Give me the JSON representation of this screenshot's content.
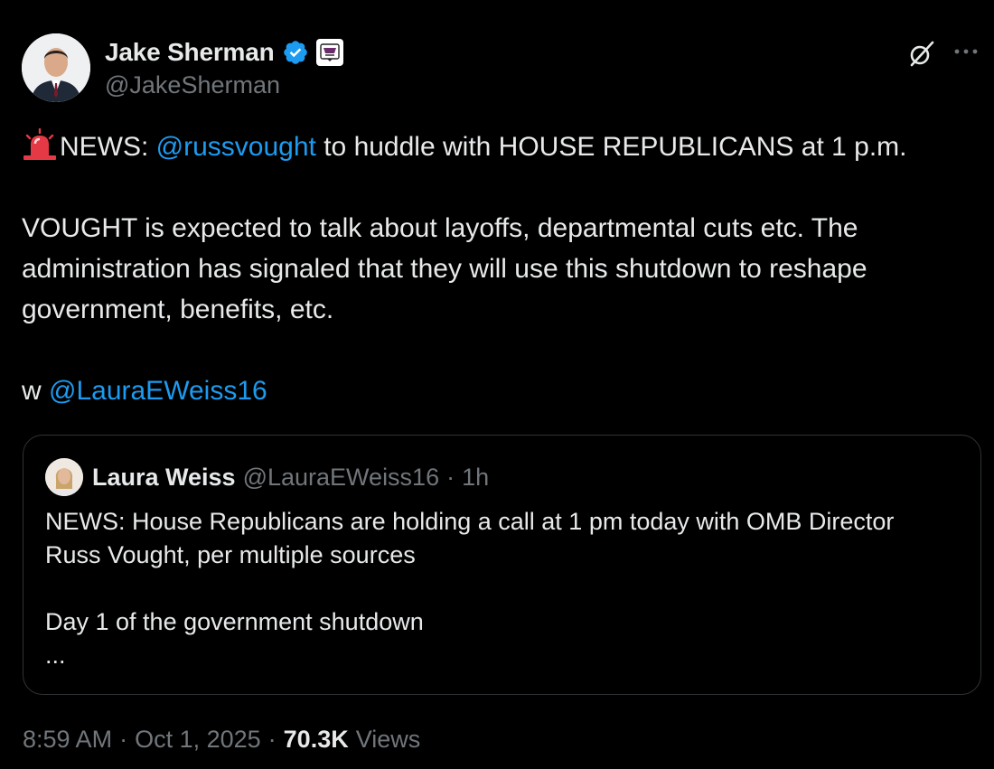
{
  "author": {
    "display_name": "Jake Sherman",
    "handle": "@JakeSherman",
    "avatar": "avatar-photo",
    "verified_color": "#1d9bf0"
  },
  "tweet": {
    "line1_prefix": "NEWS: ",
    "line1_mention": "@russvought",
    "line1_suffix": " to huddle with HOUSE REPUBLICANS at 1 p.m.",
    "para2_line1": "VOUGHT is expected to talk about layoffs, departmental cuts etc. The",
    "para2_line2": "administration has signaled that they will use this shutdown to reshape",
    "para2_line3": "government, benefits, etc.",
    "para3_prefix": "w ",
    "para3_mention": "@LauraEWeiss16",
    "emoji": "siren-icon"
  },
  "quote": {
    "display_name": "Laura Weiss",
    "handle": "@LauraEWeiss16",
    "separator": "·",
    "time": "1h",
    "line1": "NEWS: House Republicans are holding a call at 1 pm today with OMB Director",
    "line2": "Russ Vought, per multiple sources",
    "line3": "Day 1 of the government shutdown",
    "line4": "..."
  },
  "meta": {
    "time": "8:59 AM",
    "sep1": "·",
    "date": "Oct 1, 2025",
    "sep2": "·",
    "views_count": "70.3K",
    "views_label": "Views"
  },
  "colors": {
    "background": "#000000",
    "text": "#e7e9ea",
    "secondary": "#71767b",
    "link": "#1d9bf0",
    "border": "#2f3336"
  }
}
